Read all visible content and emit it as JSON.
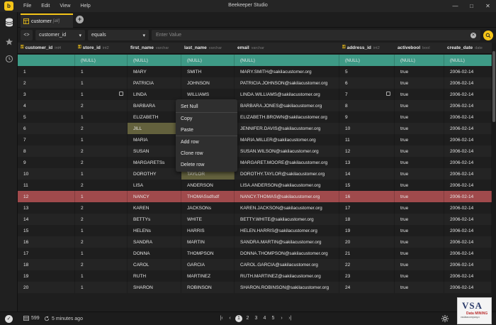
{
  "window": {
    "title": "Beekeeper Studio",
    "menu": [
      "File",
      "Edit",
      "View",
      "Help"
    ]
  },
  "tab": {
    "name": "customer",
    "sub": "[all]"
  },
  "filter": {
    "column": "customer_id",
    "operator": "equals",
    "value_placeholder": "Enter Value"
  },
  "columns": [
    {
      "name": "customer_id",
      "type": "int4",
      "key": true
    },
    {
      "name": "store_id",
      "type": "int2",
      "key": true
    },
    {
      "name": "first_name",
      "type": "varchar",
      "key": false
    },
    {
      "name": "last_name",
      "type": "varchar",
      "key": false
    },
    {
      "name": "email",
      "type": "varchar",
      "key": false
    },
    {
      "name": "address_id",
      "type": "int2",
      "key": true
    },
    {
      "name": "activebool",
      "type": "bool",
      "key": false
    },
    {
      "name": "create_date",
      "type": "date",
      "key": false
    }
  ],
  "rows": [
    {
      "status": "new",
      "cells": [
        "",
        "(NULL)",
        "(NULL)",
        "(NULL)",
        "(NULL)",
        "(NULL)",
        "(NULL)",
        "(NULL)"
      ]
    },
    {
      "cells": [
        "1",
        "1",
        "MARY",
        "SMITH",
        "MARY.SMITH@sakilacustomer.org",
        "5",
        "true",
        "2006-02-14"
      ]
    },
    {
      "cells": [
        "2",
        "1",
        "PATRICIA",
        "JOHNSON",
        "PATRICIA.JOHNSON@sakilacustomer.org",
        "6",
        "true",
        "2006-02-14"
      ]
    },
    {
      "cells": [
        "3",
        "1",
        "LINDA",
        "WILLIAMS",
        "LINDA.WILLIAMS@sakilacustomer.org",
        "7",
        "true",
        "2006-02-14"
      ]
    },
    {
      "cells": [
        "4",
        "2",
        "BARBARA",
        "JONES",
        "BARBARA.JONES@sakilacustomer.org",
        "8",
        "true",
        "2006-02-14"
      ]
    },
    {
      "cells": [
        "5",
        "1",
        "ELIZABETH",
        "BROWN",
        "ELIZABETH.BROWN@sakilacustomer.org",
        "9",
        "true",
        "2006-02-14"
      ]
    },
    {
      "cells": [
        "6",
        "2",
        "JILL",
        "DAVIS",
        "JENNIFER.DAVIS@sakilacustomer.org",
        "10",
        "true",
        "2006-02-14"
      ],
      "edited": [
        2
      ]
    },
    {
      "cells": [
        "7",
        "1",
        "MARIA",
        "MILLER",
        "MARIA.MILLER@sakilacustomer.org",
        "11",
        "true",
        "2006-02-14"
      ]
    },
    {
      "cells": [
        "8",
        "2",
        "SUSAN",
        "WILSON",
        "SUSAN.WILSON@sakilacustomer.org",
        "12",
        "true",
        "2006-02-14"
      ]
    },
    {
      "cells": [
        "9",
        "2",
        "MARGARETSs",
        "MOORE",
        "MARGARET.MOORE@sakilacustomer.org",
        "13",
        "true",
        "2006-02-14"
      ]
    },
    {
      "cells": [
        "10",
        "1",
        "DOROTHY",
        "TAYLOR",
        "DOROTHY.TAYLOR@sakilacustomer.org",
        "14",
        "true",
        "2006-02-14"
      ],
      "edited": [
        3
      ]
    },
    {
      "cells": [
        "11",
        "2",
        "LISA",
        "ANDERSON",
        "LISA.ANDERSON@sakilacustomer.org",
        "15",
        "true",
        "2006-02-14"
      ]
    },
    {
      "status": "deleted",
      "cells": [
        "12",
        "1",
        "NANCY",
        "THOMASsdfsdf",
        "NANCY.THOMAS@sakilacustomer.org",
        "16",
        "true",
        "2006-02-14"
      ]
    },
    {
      "cells": [
        "13",
        "2",
        "KAREN",
        "JACKSONs",
        "KAREN.JACKSON@sakilacustomer.org",
        "17",
        "true",
        "2006-02-14"
      ]
    },
    {
      "cells": [
        "14",
        "2",
        "BETTYs",
        "WHITE",
        "BETTY.WHITE@sakilacustomer.org",
        "18",
        "true",
        "2006-02-14"
      ]
    },
    {
      "cells": [
        "15",
        "1",
        "HELENs",
        "HARRIS",
        "HELEN.HARRIS@sakilacustomer.org",
        "19",
        "true",
        "2006-02-14"
      ]
    },
    {
      "cells": [
        "16",
        "2",
        "SANDRA",
        "MARTIN",
        "SANDRA.MARTIN@sakilacustomer.org",
        "20",
        "true",
        "2006-02-14"
      ]
    },
    {
      "cells": [
        "17",
        "1",
        "DONNA",
        "THOMPSON",
        "DONNA.THOMPSON@sakilacustomer.org",
        "21",
        "true",
        "2006-02-14"
      ]
    },
    {
      "cells": [
        "18",
        "2",
        "CAROL",
        "GARCIA",
        "CAROL.GARCIA@sakilacustomer.org",
        "22",
        "true",
        "2006-02-14"
      ]
    },
    {
      "cells": [
        "19",
        "1",
        "RUTH",
        "MARTINEZ",
        "RUTH.MARTINEZ@sakilacustomer.org",
        "23",
        "true",
        "2006-02-14"
      ]
    },
    {
      "cells": [
        "20",
        "1",
        "SHARON",
        "ROBINSON",
        "SHARON.ROBINSON@sakilacustomer.org",
        "24",
        "true",
        "2006-02-14"
      ]
    }
  ],
  "context_menu": [
    "Set Null",
    "Copy",
    "Paste",
    "Add row",
    "Clone row",
    "Delete row"
  ],
  "footer": {
    "row_count": "599",
    "updated": "5 minutes ago",
    "pages": [
      "1",
      "2",
      "3",
      "4",
      "5"
    ],
    "active_page": "1"
  },
  "watermark": {
    "big": "VSA",
    "sub": "Data MINING",
    "url": "vsdatacompany.c"
  },
  "colors": {
    "accent": "#f5c518",
    "new_row": "#3e9a86",
    "deleted_row": "#a04a4c",
    "edited_cell": "#63613d"
  }
}
